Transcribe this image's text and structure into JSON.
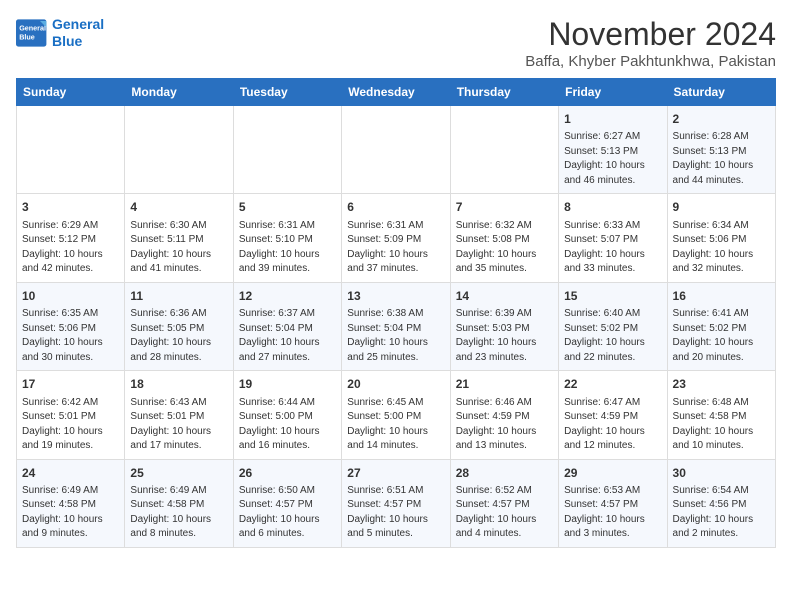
{
  "header": {
    "logo_line1": "General",
    "logo_line2": "Blue",
    "month": "November 2024",
    "location": "Baffa, Khyber Pakhtunkhwa, Pakistan"
  },
  "days_of_week": [
    "Sunday",
    "Monday",
    "Tuesday",
    "Wednesday",
    "Thursday",
    "Friday",
    "Saturday"
  ],
  "weeks": [
    [
      {
        "day": "",
        "content": ""
      },
      {
        "day": "",
        "content": ""
      },
      {
        "day": "",
        "content": ""
      },
      {
        "day": "",
        "content": ""
      },
      {
        "day": "",
        "content": ""
      },
      {
        "day": "1",
        "content": "Sunrise: 6:27 AM\nSunset: 5:13 PM\nDaylight: 10 hours and 46 minutes."
      },
      {
        "day": "2",
        "content": "Sunrise: 6:28 AM\nSunset: 5:13 PM\nDaylight: 10 hours and 44 minutes."
      }
    ],
    [
      {
        "day": "3",
        "content": "Sunrise: 6:29 AM\nSunset: 5:12 PM\nDaylight: 10 hours and 42 minutes."
      },
      {
        "day": "4",
        "content": "Sunrise: 6:30 AM\nSunset: 5:11 PM\nDaylight: 10 hours and 41 minutes."
      },
      {
        "day": "5",
        "content": "Sunrise: 6:31 AM\nSunset: 5:10 PM\nDaylight: 10 hours and 39 minutes."
      },
      {
        "day": "6",
        "content": "Sunrise: 6:31 AM\nSunset: 5:09 PM\nDaylight: 10 hours and 37 minutes."
      },
      {
        "day": "7",
        "content": "Sunrise: 6:32 AM\nSunset: 5:08 PM\nDaylight: 10 hours and 35 minutes."
      },
      {
        "day": "8",
        "content": "Sunrise: 6:33 AM\nSunset: 5:07 PM\nDaylight: 10 hours and 33 minutes."
      },
      {
        "day": "9",
        "content": "Sunrise: 6:34 AM\nSunset: 5:06 PM\nDaylight: 10 hours and 32 minutes."
      }
    ],
    [
      {
        "day": "10",
        "content": "Sunrise: 6:35 AM\nSunset: 5:06 PM\nDaylight: 10 hours and 30 minutes."
      },
      {
        "day": "11",
        "content": "Sunrise: 6:36 AM\nSunset: 5:05 PM\nDaylight: 10 hours and 28 minutes."
      },
      {
        "day": "12",
        "content": "Sunrise: 6:37 AM\nSunset: 5:04 PM\nDaylight: 10 hours and 27 minutes."
      },
      {
        "day": "13",
        "content": "Sunrise: 6:38 AM\nSunset: 5:04 PM\nDaylight: 10 hours and 25 minutes."
      },
      {
        "day": "14",
        "content": "Sunrise: 6:39 AM\nSunset: 5:03 PM\nDaylight: 10 hours and 23 minutes."
      },
      {
        "day": "15",
        "content": "Sunrise: 6:40 AM\nSunset: 5:02 PM\nDaylight: 10 hours and 22 minutes."
      },
      {
        "day": "16",
        "content": "Sunrise: 6:41 AM\nSunset: 5:02 PM\nDaylight: 10 hours and 20 minutes."
      }
    ],
    [
      {
        "day": "17",
        "content": "Sunrise: 6:42 AM\nSunset: 5:01 PM\nDaylight: 10 hours and 19 minutes."
      },
      {
        "day": "18",
        "content": "Sunrise: 6:43 AM\nSunset: 5:01 PM\nDaylight: 10 hours and 17 minutes."
      },
      {
        "day": "19",
        "content": "Sunrise: 6:44 AM\nSunset: 5:00 PM\nDaylight: 10 hours and 16 minutes."
      },
      {
        "day": "20",
        "content": "Sunrise: 6:45 AM\nSunset: 5:00 PM\nDaylight: 10 hours and 14 minutes."
      },
      {
        "day": "21",
        "content": "Sunrise: 6:46 AM\nSunset: 4:59 PM\nDaylight: 10 hours and 13 minutes."
      },
      {
        "day": "22",
        "content": "Sunrise: 6:47 AM\nSunset: 4:59 PM\nDaylight: 10 hours and 12 minutes."
      },
      {
        "day": "23",
        "content": "Sunrise: 6:48 AM\nSunset: 4:58 PM\nDaylight: 10 hours and 10 minutes."
      }
    ],
    [
      {
        "day": "24",
        "content": "Sunrise: 6:49 AM\nSunset: 4:58 PM\nDaylight: 10 hours and 9 minutes."
      },
      {
        "day": "25",
        "content": "Sunrise: 6:49 AM\nSunset: 4:58 PM\nDaylight: 10 hours and 8 minutes."
      },
      {
        "day": "26",
        "content": "Sunrise: 6:50 AM\nSunset: 4:57 PM\nDaylight: 10 hours and 6 minutes."
      },
      {
        "day": "27",
        "content": "Sunrise: 6:51 AM\nSunset: 4:57 PM\nDaylight: 10 hours and 5 minutes."
      },
      {
        "day": "28",
        "content": "Sunrise: 6:52 AM\nSunset: 4:57 PM\nDaylight: 10 hours and 4 minutes."
      },
      {
        "day": "29",
        "content": "Sunrise: 6:53 AM\nSunset: 4:57 PM\nDaylight: 10 hours and 3 minutes."
      },
      {
        "day": "30",
        "content": "Sunrise: 6:54 AM\nSunset: 4:56 PM\nDaylight: 10 hours and 2 minutes."
      }
    ]
  ]
}
